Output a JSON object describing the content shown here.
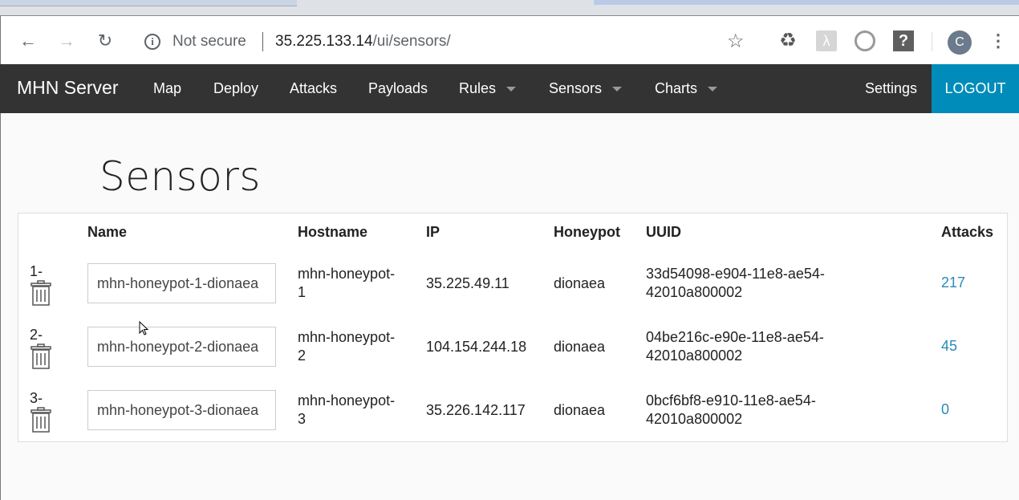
{
  "browser": {
    "security_label": "Not secure",
    "url_host": "35.225.133.14",
    "url_path": "/ui/sensors/",
    "avatar_letter": "C",
    "icons": [
      "back-icon",
      "forward-icon",
      "reload-icon",
      "info-icon",
      "star-icon",
      "recycle-extension-icon",
      "pdf-extension-icon",
      "circle-extension-icon",
      "help-extension-icon",
      "menu-dots-icon"
    ]
  },
  "navbar": {
    "brand": "MHN Server",
    "links": [
      "Map",
      "Deploy",
      "Attacks",
      "Payloads",
      "Rules",
      "Sensors",
      "Charts"
    ],
    "settings": "Settings",
    "logout": "LOGOUT",
    "bg_color": "#333333",
    "logout_color": "#008cba"
  },
  "page": {
    "title": "Sensors",
    "columns": {
      "name": "Name",
      "hostname": "Hostname",
      "ip": "IP",
      "honeypot": "Honeypot",
      "uuid": "UUID",
      "attacks": "Attacks"
    },
    "rows": [
      {
        "index": "1-",
        "name": "mhn-honeypot-1-dionaea",
        "hostname_1": "mhn-honeypot-",
        "hostname_2": "1",
        "ip": "35.225.49.11",
        "honeypot": "dionaea",
        "uuid_1": "33d54098-e904-11e8-ae54-",
        "uuid_2": "42010a800002",
        "attacks": "217"
      },
      {
        "index": "2-",
        "name": "mhn-honeypot-2-dionaea",
        "hostname_1": "mhn-honeypot-",
        "hostname_2": "2",
        "ip": "104.154.244.18",
        "honeypot": "dionaea",
        "uuid_1": "04be216c-e90e-11e8-ae54-",
        "uuid_2": "42010a800002",
        "attacks": "45"
      },
      {
        "index": "3-",
        "name": "mhn-honeypot-3-dionaea",
        "hostname_1": "mhn-honeypot-",
        "hostname_2": "3",
        "ip": "35.226.142.117",
        "honeypot": "dionaea",
        "uuid_1": "0bcf6bf8-e910-11e8-ae54-",
        "uuid_2": "42010a800002",
        "attacks": "0"
      }
    ],
    "link_color": "#2a8bb5"
  }
}
